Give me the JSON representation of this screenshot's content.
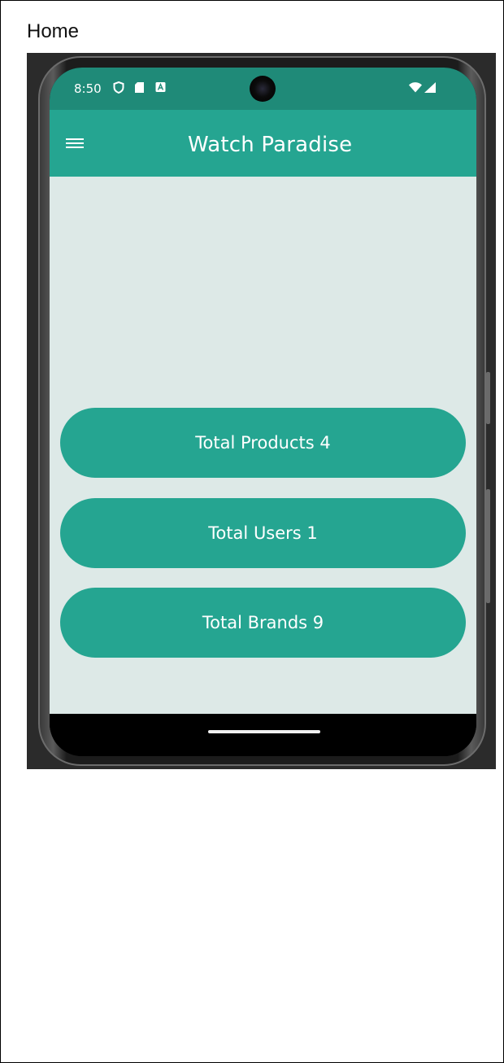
{
  "document": {
    "title": "Home"
  },
  "status_bar": {
    "time": "8:50",
    "icons": [
      "shield-icon",
      "sd-card-icon",
      "keyboard-icon",
      "wifi-icon",
      "signal-icon"
    ]
  },
  "app_bar": {
    "title": "Watch Paradise",
    "menu_icon": "menu-icon"
  },
  "stats": [
    {
      "label": "Total Products 4"
    },
    {
      "label": "Total Users 1"
    },
    {
      "label": "Total Brands 9"
    }
  ],
  "colors": {
    "status_bar": "#1f8a78",
    "primary": "#25a591",
    "background": "#dde9e7",
    "text_on_primary": "#ffffff"
  }
}
